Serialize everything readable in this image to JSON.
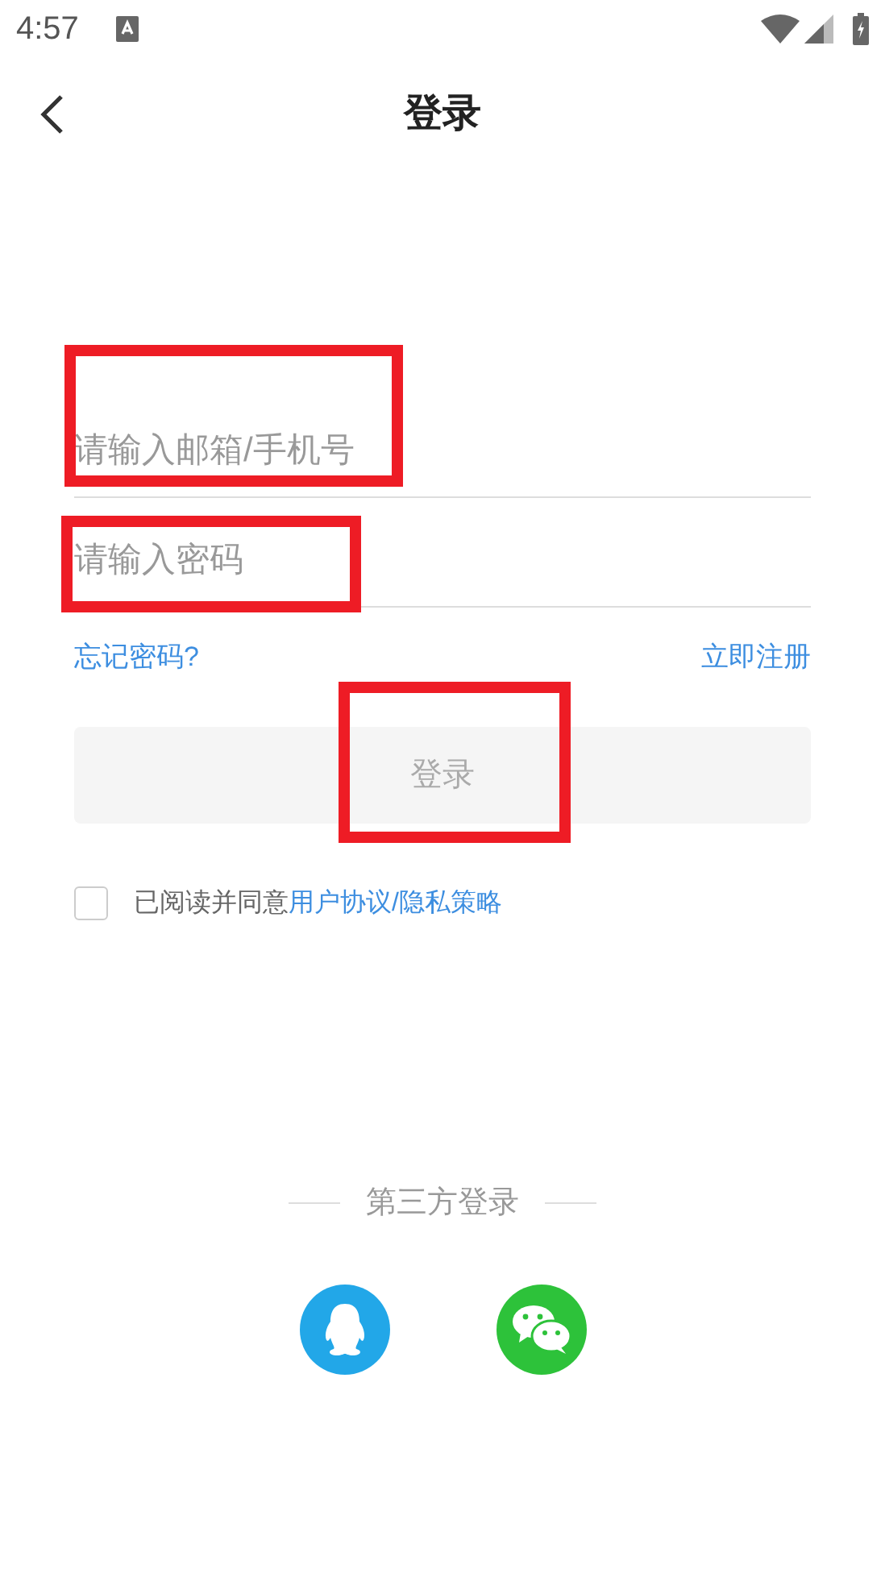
{
  "status_bar": {
    "time": "4:57"
  },
  "header": {
    "title": "登录"
  },
  "account_field": {
    "placeholder": "请输入邮箱/手机号",
    "highlighted": true
  },
  "password_field": {
    "placeholder": "请输入密码",
    "highlighted": true
  },
  "links": {
    "forgot": "忘记密码?",
    "register": "立即注册"
  },
  "login_button": {
    "label": "登录",
    "highlighted": true,
    "disabled": true
  },
  "agreement": {
    "checked": false,
    "prefix": "已阅读并同意",
    "terms": "用户协议",
    "separator": "/",
    "privacy": "隐私策略"
  },
  "third_party": {
    "title": "第三方登录"
  }
}
